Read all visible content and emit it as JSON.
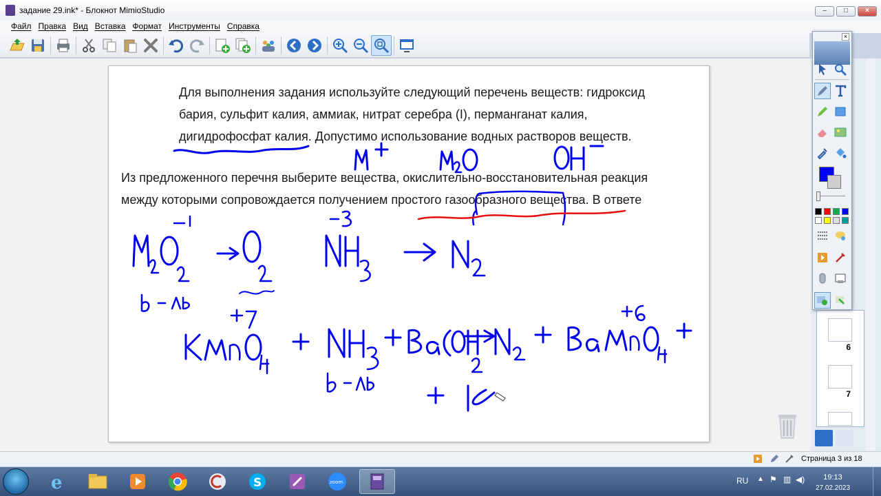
{
  "window": {
    "title": "задание 29.ink* - Блокнот MimioStudio",
    "min": "–",
    "max": "□",
    "close": "×"
  },
  "menu": [
    "Файл",
    "Правка",
    "Вид",
    "Вставка",
    "Формат",
    "Инструменты",
    "Справка"
  ],
  "toolbar": {
    "icons": [
      "open-icon",
      "save-icon",
      "print-icon",
      "cut-icon",
      "copy-icon",
      "paste-icon",
      "delete-icon",
      "undo-icon",
      "redo-icon",
      "new-page-icon",
      "duplicate-page-icon",
      "users-icon",
      "back-icon",
      "forward-icon",
      "zoom-in-icon",
      "zoom-out-icon",
      "zoom-fit-icon",
      "screen-icon"
    ]
  },
  "page": {
    "paragraph1": [
      "Для выполнения задания используйте следующий перечень веществ: гидроксид",
      "бария, сульфит калия, аммиак, нитрат серебра (I), перманганат калия,",
      "дигидрофосфат калия. Допустимо использование водных растворов веществ."
    ],
    "paragraph2": [
      "Из предложенного перечня выберите вещества, окислительно-восстановительная реакция",
      "между которыми сопровождается получением простого газообразного вещества. В ответе"
    ]
  },
  "palette": {
    "close": "×",
    "colors": [
      "#000000",
      "#ff0000",
      "#00b050",
      "#0000ff",
      "#ffffff",
      "#ffff00",
      "#e0e0e0",
      "#00a0a0"
    ],
    "current_color": "#0000ff"
  },
  "thumbnails": {
    "numbers": [
      "6",
      "7"
    ]
  },
  "statusbar": {
    "page_indicator": "Страница 3 из 18"
  },
  "taskbar": {
    "lang": "RU",
    "time": "19:13",
    "date": "27.02.2023"
  }
}
